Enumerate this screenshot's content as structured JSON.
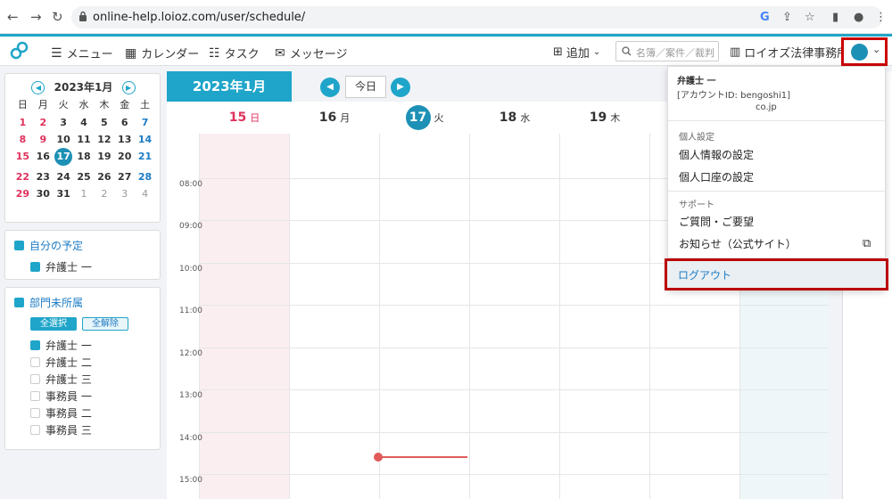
{
  "browser": {
    "url": "online-help.loioz.com/user/schedule/"
  },
  "header": {
    "menu_label": "メニュー",
    "calendar_label": "カレンダー",
    "task_label": "タスク",
    "message_label": "メッセージ",
    "add_label": "追加",
    "search_placeholder": "名簿／案件／裁判",
    "firm_name": "ロイオズ法律事務所"
  },
  "mini_calendar": {
    "title": "2023年1月",
    "weekdays": [
      "日",
      "月",
      "火",
      "水",
      "木",
      "金",
      "土"
    ],
    "days": [
      [
        "1",
        "2",
        "3",
        "4",
        "5",
        "6",
        "7"
      ],
      [
        "8",
        "9",
        "10",
        "11",
        "12",
        "13",
        "14"
      ],
      [
        "15",
        "16",
        "17",
        "18",
        "19",
        "20",
        "21"
      ],
      [
        "22",
        "23",
        "24",
        "25",
        "26",
        "27",
        "28"
      ],
      [
        "29",
        "30",
        "31",
        "1",
        "2",
        "3",
        "4"
      ]
    ]
  },
  "my_schedule": {
    "title": "自分の予定",
    "items": [
      "弁護士 一"
    ]
  },
  "dept": {
    "title": "部門未所属",
    "select_all": "全選択",
    "clear_all": "全解除",
    "items": [
      "弁護士 一",
      "弁護士 二",
      "弁護士 三",
      "事務員 一",
      "事務員 二",
      "事務員 三"
    ]
  },
  "calendar": {
    "month_title": "2023年1月",
    "today_button": "今日",
    "days": [
      {
        "num": "15",
        "dow": "日"
      },
      {
        "num": "16",
        "dow": "月"
      },
      {
        "num": "17",
        "dow": "火"
      },
      {
        "num": "18",
        "dow": "水"
      },
      {
        "num": "19",
        "dow": "木"
      }
    ],
    "times": [
      "08:00",
      "09:00",
      "10:00",
      "11:00",
      "12:00",
      "13:00",
      "14:00",
      "15:00"
    ]
  },
  "dropdown": {
    "user_name": "弁護士 一",
    "account_id": "[アカウントID: bengoshi1]",
    "account_id_suffix": "co.jp",
    "personal_section": "個人設定",
    "personal_info": "個人情報の設定",
    "personal_account": "個人口座の設定",
    "support_section": "サポート",
    "questions": "ご質問・ご要望",
    "notices": "お知らせ（公式サイト）",
    "logout": "ログアウト"
  }
}
